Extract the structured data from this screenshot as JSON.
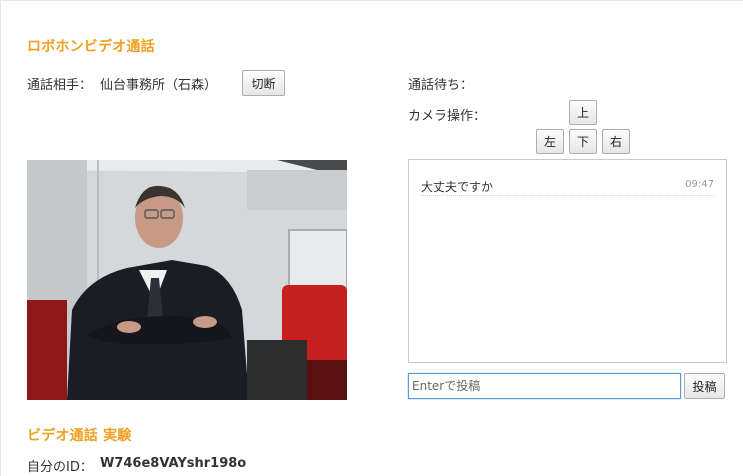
{
  "header": {
    "title": "ロボホンビデオ通話"
  },
  "call": {
    "partner_label": "通話相手：",
    "partner_name": "仙台事務所（石森）",
    "disconnect_label": "切断"
  },
  "status": {
    "waiting_label": "通話待ち："
  },
  "camera": {
    "label": "カメラ操作：",
    "up": "上",
    "left": "左",
    "down": "下",
    "right": "右"
  },
  "chat": {
    "messages": [
      {
        "text": "大丈夫ですか",
        "time": "09:47"
      }
    ],
    "input_placeholder": "Enterで投稿",
    "post_label": "投稿"
  },
  "experiment": {
    "title": "ビデオ通話 実験",
    "my_id_label": "自分のID：",
    "my_id_value": "W746e8VAYshr198o"
  },
  "colors": {
    "accent": "#f0a020",
    "input_focus": "#5b9bd5"
  }
}
